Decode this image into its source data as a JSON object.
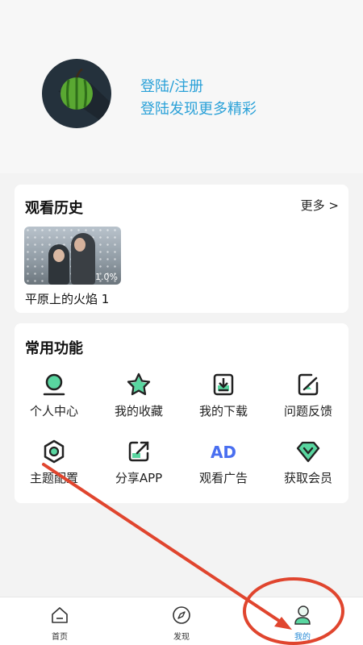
{
  "profile": {
    "login_link": "登陆/注册",
    "login_sub": "登陆发现更多精彩"
  },
  "history": {
    "title": "观看历史",
    "more": "更多 >",
    "item": {
      "title": "平原上的火焰 1",
      "progress": "1.0%"
    }
  },
  "functions": {
    "title": "常用功能",
    "items": [
      {
        "label": "个人中心",
        "icon": "person-icon"
      },
      {
        "label": "我的收藏",
        "icon": "star-icon"
      },
      {
        "label": "我的下载",
        "icon": "download-icon"
      },
      {
        "label": "问题反馈",
        "icon": "feedback-icon"
      },
      {
        "label": "主题配置",
        "icon": "theme-icon"
      },
      {
        "label": "分享APP",
        "icon": "share-icon"
      },
      {
        "label": "观看广告",
        "icon": "ad-icon",
        "icon_text": "AD"
      },
      {
        "label": "获取会员",
        "icon": "vip-icon"
      }
    ]
  },
  "tabbar": {
    "items": [
      {
        "label": "首页",
        "icon": "home-icon"
      },
      {
        "label": "发现",
        "icon": "compass-icon"
      },
      {
        "label": "我的",
        "icon": "profile-icon",
        "active": true
      }
    ]
  },
  "colors": {
    "accent_blue": "#2aa1d8",
    "accent_green": "#59d6a0",
    "annotation_red": "#e0452e"
  }
}
